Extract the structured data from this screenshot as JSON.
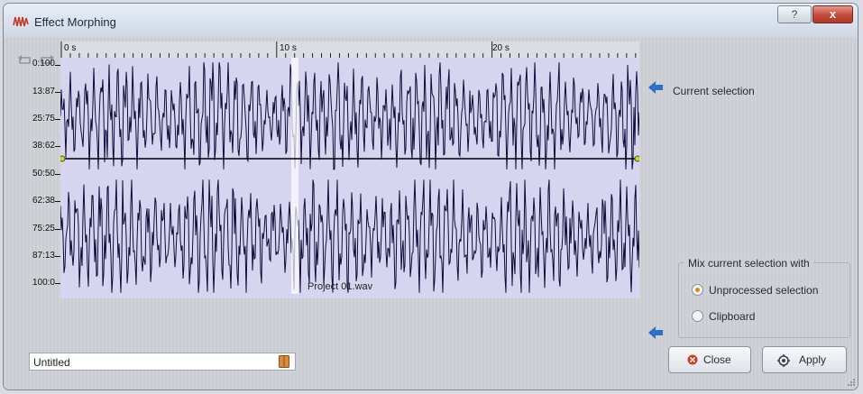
{
  "window": {
    "title": "Effect Morphing",
    "help_label": "?",
    "close_label": "x"
  },
  "toolbar": {
    "icons": [
      "undo-icon",
      "redo-icon",
      "add-node-icon",
      "remove-node-icon",
      "zero-icon",
      "link-icon",
      "flip-vertical-icon",
      "flip-horizontal-icon",
      "curve-icon"
    ]
  },
  "waveform": {
    "time_labels": [
      "0 s",
      "10 s",
      "20 s"
    ],
    "mix_labels": [
      "0:100",
      "13:87",
      "25:75",
      "38:62",
      "50:50",
      "62:38",
      "75:25",
      "87:13",
      "100:0"
    ],
    "file_name": "Project 01.wav",
    "fill_color": "#d7d4ef",
    "wave_color": "#0c0c3a"
  },
  "right_panel": {
    "current_selection_label": "Current selection",
    "mix_group_title": "Mix current selection with",
    "options": [
      {
        "label": "Unprocessed selection",
        "selected": true
      },
      {
        "label": "Clipboard",
        "selected": false
      }
    ]
  },
  "preset": {
    "value": "Untitled"
  },
  "buttons": {
    "close_label": "Close",
    "apply_label": "Apply"
  }
}
